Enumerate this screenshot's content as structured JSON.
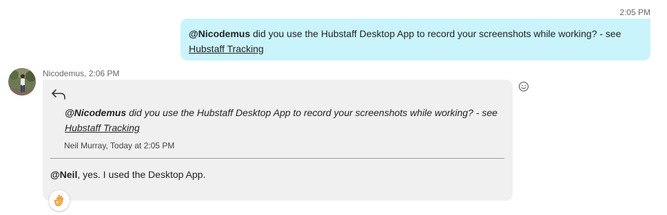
{
  "outgoing": {
    "time": "2:05 PM",
    "mention": "@Nicodemus",
    "text": " did you use the Hubstaff Desktop App to record your screenshots while working? - see",
    "link": "Hubstaff Tracking"
  },
  "incoming": {
    "sender": "Nicodemus",
    "time": "2:06 PM",
    "quote": {
      "mention": "@Nicodemus",
      "text": " did you use the Hubstaff Desktop App to record your screenshots while working? - see",
      "link": "Hubstaff Tracking",
      "meta": "Neil Murray, Today at 2:05 PM"
    },
    "reply": {
      "mention": "@Neil",
      "text": ", yes. I used the Desktop App."
    },
    "reaction_icon": "ok-hand-icon"
  },
  "colors": {
    "outgoing_bubble": "#c9f4fb",
    "incoming_bubble": "#f0f0f0",
    "timestamp": "#666666"
  }
}
